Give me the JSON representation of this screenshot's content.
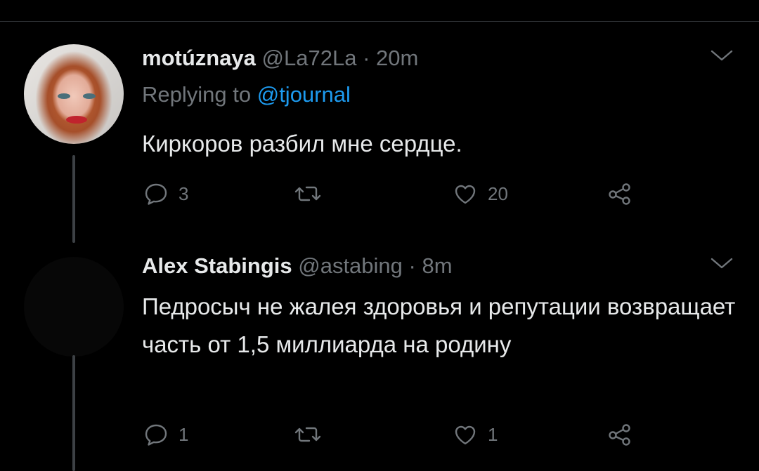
{
  "tweets": [
    {
      "name": "motúznaya",
      "handle": "@La72La",
      "separator": "·",
      "time": "20m",
      "replying_prefix": "Replying to ",
      "replying_to": "@tjournal",
      "text": "Киркоров разбил мне сердце.",
      "replies": "3",
      "retweets": "",
      "likes": "20"
    },
    {
      "name": "Alex Stabingis",
      "handle": "@astabing",
      "separator": "·",
      "time": "8m",
      "text": "Педросыч не жалея здоровья и репутации возвращает часть от 1,5 миллиарда на родину",
      "replies": "1",
      "retweets": "",
      "likes": "1"
    }
  ],
  "icons": {
    "reply": "reply-icon",
    "retweet": "retweet-icon",
    "like": "heart-icon",
    "share": "share-icon",
    "menu": "chevron-down-icon"
  },
  "colors": {
    "background": "#000000",
    "text": "#e7e9ea",
    "muted": "#71767b",
    "link": "#1d9bf0"
  }
}
